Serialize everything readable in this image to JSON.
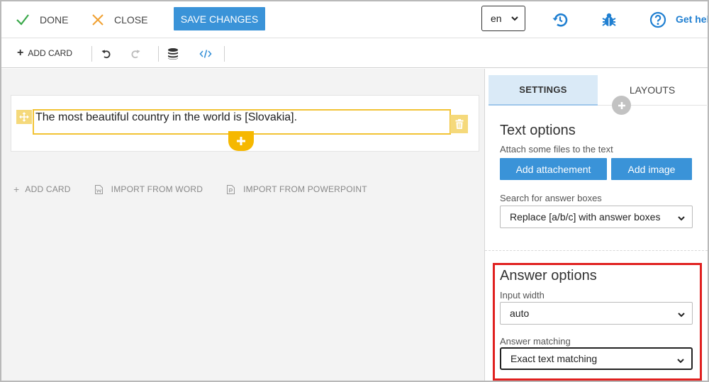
{
  "topbar": {
    "done_label": "DONE",
    "close_label": "CLOSE",
    "save_label": "SAVE CHANGES",
    "language": "en",
    "help_label": "Get hel"
  },
  "toolbar": {
    "add_card_label": "ADD CARD"
  },
  "card": {
    "text": "The most beautiful country in the world is [Slovakia]."
  },
  "bottom_actions": {
    "add_card": "ADD CARD",
    "import_word": "IMPORT FROM WORD",
    "import_ppt": "IMPORT FROM POWERPOINT"
  },
  "panel": {
    "tabs": [
      {
        "label": "SETTINGS",
        "active": true
      },
      {
        "label": "LAYOUTS",
        "active": false
      }
    ],
    "text_options": {
      "title": "Text options",
      "attach_label": "Attach some files to the text",
      "add_attachment": "Add attachement",
      "add_image": "Add image",
      "search_label": "Search for answer boxes",
      "search_value": "Replace [a/b/c] with answer boxes"
    },
    "answer_options": {
      "title": "Answer options",
      "input_width_label": "Input width",
      "input_width_value": "auto",
      "matching_label": "Answer matching",
      "matching_value": "Exact text matching"
    }
  },
  "colors": {
    "accent_blue": "#3a93d8",
    "done_green": "#3aa84a",
    "close_orange": "#f0a030",
    "card_yellow": "#f2c335",
    "highlight_red": "#e0201f"
  }
}
